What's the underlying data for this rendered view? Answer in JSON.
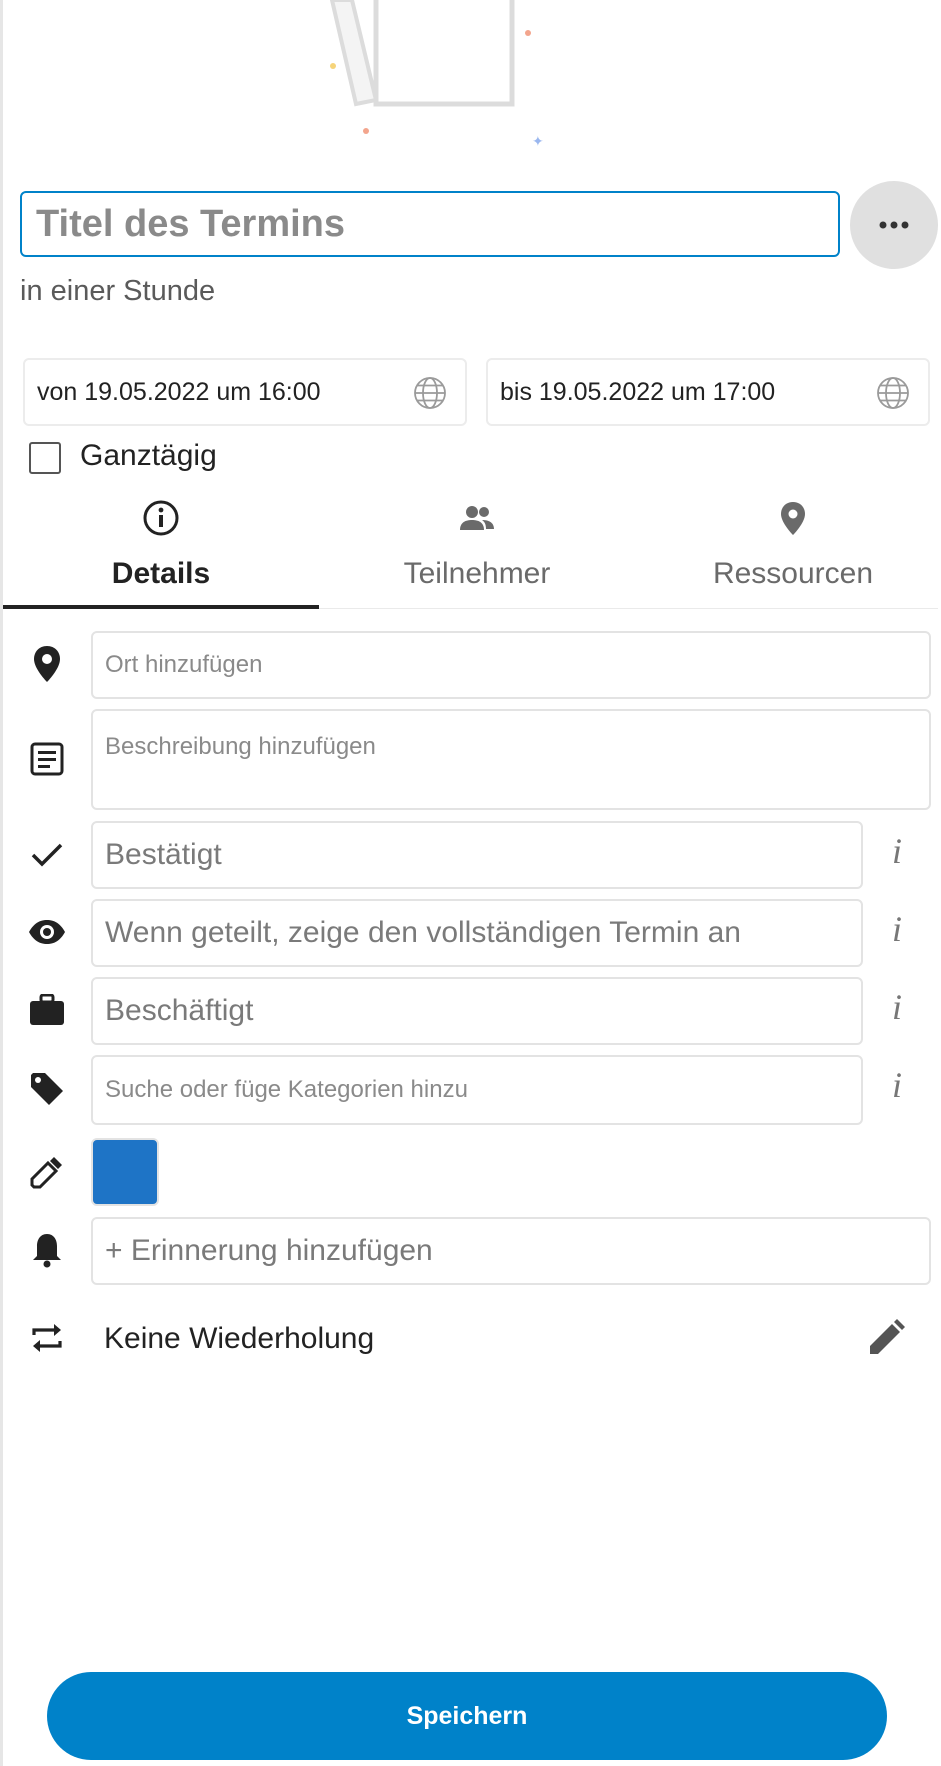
{
  "title_field": {
    "placeholder": "Titel des Termins",
    "value": ""
  },
  "subtitle": "in einer Stunde",
  "dates": {
    "start": "von 19.05.2022 um 16:00",
    "end": "bis 19.05.2022 um 17:00"
  },
  "all_day": {
    "label": "Ganztägig",
    "checked": false
  },
  "tabs": [
    {
      "label": "Details",
      "icon": "info-icon",
      "active": true
    },
    {
      "label": "Teilnehmer",
      "icon": "people-icon",
      "active": false
    },
    {
      "label": "Ressourcen",
      "icon": "location-pin-icon",
      "active": false
    }
  ],
  "details": {
    "location": {
      "placeholder": "Ort hinzufügen"
    },
    "description": {
      "placeholder": "Beschreibung hinzufügen"
    },
    "status": {
      "value": "Bestätigt"
    },
    "visibility": {
      "value": "Wenn geteilt, zeige den vollständigen Termin an"
    },
    "availability": {
      "value": "Beschäftigt"
    },
    "categories": {
      "placeholder": "Suche oder füge Kategorien hinzu"
    },
    "color": "#1e74c6",
    "reminder": {
      "label": "+ Erinnerung hinzufügen"
    },
    "repeat": {
      "label": "Keine Wiederholung"
    },
    "info_glyph": "i"
  },
  "save_button": {
    "label": "Speichern"
  },
  "colors": {
    "accent": "#0082c9",
    "chip_bg": "#e0e0e0"
  }
}
